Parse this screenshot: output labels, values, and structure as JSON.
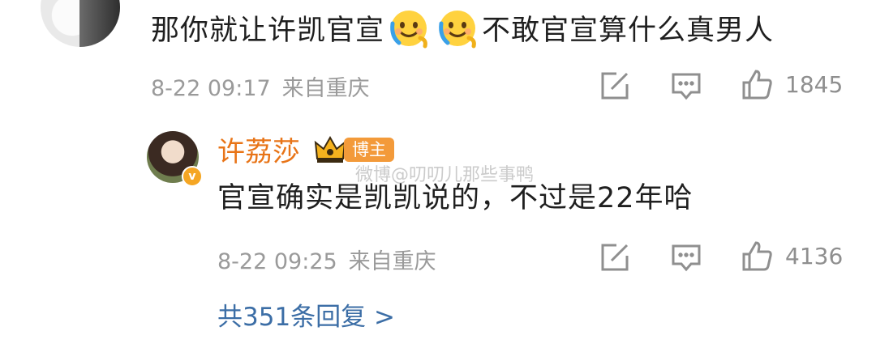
{
  "comment": {
    "text_part1": "那你就让许凯官宣",
    "text_part2": "不敢官宣算什么真男人",
    "emoji_name": "smile-emoji",
    "date": "8-22 09:17",
    "source": "来自重庆",
    "like_count": "1845"
  },
  "reply": {
    "author": "许荔莎",
    "verified_badge": "v",
    "owner_badge": "博主",
    "watermark": "微博@叨叨儿那些事鸭",
    "text": "官宣确实是凯凯说的，不过是22年哈",
    "date": "8-22 09:25",
    "source": "来自重庆",
    "like_count": "4136"
  },
  "more_replies": "共351条回复 >",
  "colors": {
    "name": "#e87417",
    "link": "#3c6ea6",
    "meta": "#9a9a9a",
    "badge": "#f39a3a"
  }
}
